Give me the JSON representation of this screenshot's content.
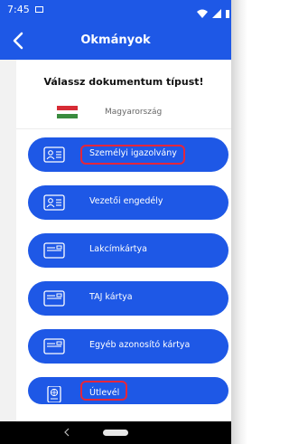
{
  "status_bar": {
    "time": "7:45"
  },
  "header": {
    "title": "Okmányok"
  },
  "prompt": "Válassz dokumentum típust!",
  "country": {
    "name": "Magyarország",
    "flag_colors": [
      "#d72b35",
      "#ffffff",
      "#3a8b3e"
    ]
  },
  "documents": [
    {
      "label": "Személyi igazolvány",
      "icon": "id-card-icon",
      "highlighted": true
    },
    {
      "label": "Vezetői engedély",
      "icon": "id-card-icon",
      "highlighted": false
    },
    {
      "label": "Lakcímkártya",
      "icon": "card-icon",
      "highlighted": false
    },
    {
      "label": "TAJ kártya",
      "icon": "card-icon",
      "highlighted": false
    },
    {
      "label": "Egyéb azonosító kártya",
      "icon": "card-icon",
      "highlighted": false
    },
    {
      "label": "Útlevél",
      "icon": "passport-icon",
      "highlighted": true
    }
  ],
  "colors": {
    "primary": "#1e58e6",
    "highlight": "#e5263b"
  }
}
